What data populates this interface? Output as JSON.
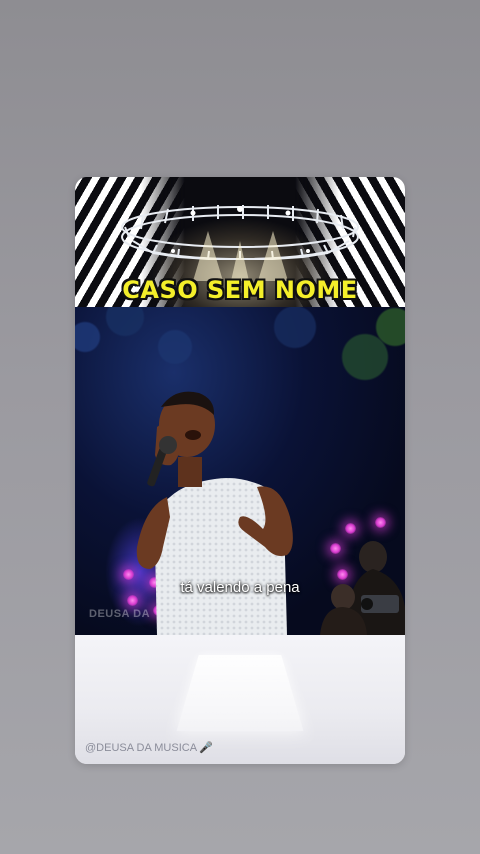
{
  "story": {
    "banner_title": "CASO SEM NOME",
    "caption": "tá valendo a pena",
    "watermark": "DEUSA DA",
    "credit": "@DEUSA DA MUSICA",
    "credit_emoji": "🎤"
  },
  "colors": {
    "title_yellow": "#f4ef2a",
    "stage_light_pink": "#d93cd0",
    "background_gray": "#9b9aa0"
  }
}
